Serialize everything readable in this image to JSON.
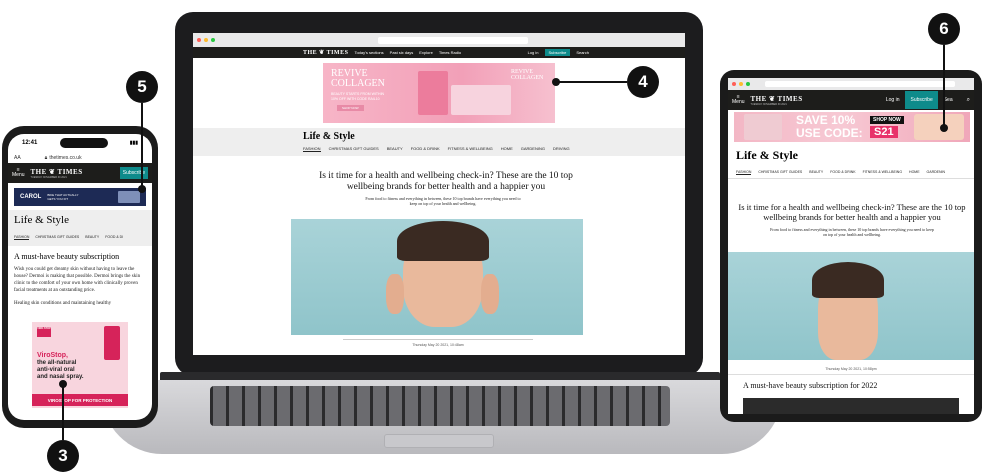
{
  "laptop": {
    "brand": "THE ❦ TIMES",
    "nav": [
      "Today's sections",
      "Past six days",
      "Explore",
      "Times Radio"
    ],
    "login": "Log in",
    "subscribe": "Subscribe",
    "search": "Search",
    "ad": {
      "line1": "REVIVE",
      "line2": "COLLAGEN",
      "line3": "BEAUTY STARTS FROM WITHIN",
      "line4": "10% OFF WITH CODE RAIL10",
      "cta": "SHOP NOW",
      "side": "REVIVE COLLAGEN"
    },
    "section_title": "Life & Style",
    "subnav": [
      "FASHION",
      "CHRISTMAS GIFT GUIDES",
      "BEAUTY",
      "FOOD & DRINK",
      "FITNESS & WELLBEING",
      "HOME",
      "GARDENING",
      "DRIVING"
    ],
    "headline": "Is it time for a health and wellbeing check-in? These are the 10 top wellbeing brands for better health and a happier you",
    "standfirst": "From food to fitness and everything in between, these 10 top brands have everything you need to keep on top of your health and wellbeing.",
    "dateline": "Thursday May 20 2021, 10:48am"
  },
  "phone": {
    "time": "12:41",
    "aa": "AA",
    "url": "thetimes.co.uk",
    "menu": "Menu",
    "brand": "THE ❦ TIMES",
    "date": "TUESDAY NOVEMBER 30 2021",
    "subscribe": "Subscribe",
    "ad_brand": "CAROL",
    "ad_text": "BIKE THAT ACTUALLY GETS YOU FIT",
    "section_title": "Life & Style",
    "subnav": [
      "FASHION",
      "CHRISTMAS GIFT GUIDES",
      "BEAUTY",
      "FOOD & DI"
    ],
    "article_title": "A must-have beauty subscription",
    "body1": "Wish you could get dreamy skin without having to leave the house? Dermoi is making that possible. Dermoi brings the skin clinic to the comfort of your own home with clinically proven facial treatments at an outstanding price.",
    "body2": "Healing skin conditions and maintaining healthy",
    "ad2_logo": "VIRO STOP",
    "ad2_title": "ViroStop,",
    "ad2_line1": "the all-natural",
    "ad2_line2": "anti-viral oral",
    "ad2_line3": "and nasal spray.",
    "ad2_cta": "VIROSTOP FOR PROTECTION"
  },
  "tablet": {
    "menu": "Menu",
    "brand": "THE ❦ TIMES",
    "date": "TUESDAY NOVEMBER 30 2021",
    "login": "Log in",
    "subscribe": "Subscribe",
    "search": "Sea",
    "ad_save": "SAVE 10%",
    "ad_code": "USE CODE:",
    "ad_code_value": "S21",
    "ad_cta": "SHOP NOW",
    "section_title": "Life & Style",
    "subnav": [
      "FASHION",
      "CHRISTMAS GIFT GUIDES",
      "BEAUTY",
      "FOOD & DRINK",
      "FITNESS & WELLBEING",
      "HOME",
      "GARDENIN"
    ],
    "headline": "Is it time for a health and wellbeing check-in? These are the 10 top wellbeing brands for better health and a happier you",
    "standfirst": "From food to fitness and everything in between, these 10 top brands have everything you need to keep on top of your health and wellbeing.",
    "dateline": "Thursday May 20 2021, 10:58pm",
    "subhead": "A must-have beauty subscription for 2022"
  },
  "callouts": {
    "c3": "3",
    "c4": "4",
    "c5": "5",
    "c6": "6"
  },
  "colors": {
    "pink_ad": "#f2a0b8",
    "teal_subscribe": "#0e8b8b",
    "photo_bg": "#9fcdd2",
    "callout": "#111111"
  }
}
